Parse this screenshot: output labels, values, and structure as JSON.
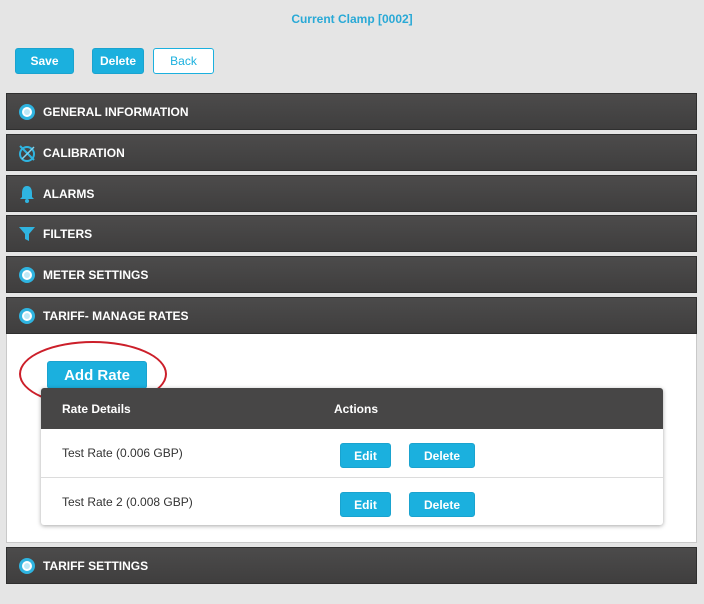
{
  "page": {
    "title": "Current Clamp [0002]"
  },
  "toolbar": {
    "save_label": "Save",
    "delete_label": "Delete",
    "back_label": "Back"
  },
  "sections": {
    "general": "GENERAL INFORMATION",
    "calibration": "CALIBRATION",
    "alarms": "ALARMS",
    "filters": "FILTERS",
    "meter": "METER SETTINGS",
    "tariff_rates": "TARIFF- MANAGE RATES",
    "tariff_settings": "TARIFF SETTINGS"
  },
  "tariff": {
    "add_rate_label": "Add Rate",
    "columns": {
      "details": "Rate Details",
      "actions": "Actions"
    },
    "rows": [
      {
        "name": "Test Rate (0.006 GBP)",
        "edit_label": "Edit",
        "delete_label": "Delete"
      },
      {
        "name": "Test Rate 2 (0.008 GBP)",
        "edit_label": "Edit",
        "delete_label": "Delete"
      }
    ]
  },
  "icons": {
    "general": "radio-dot-icon",
    "calibration": "compass-icon",
    "alarms": "bell-icon",
    "filters": "funnel-icon",
    "meter": "radio-dot-icon",
    "tariff_rates": "radio-dot-icon",
    "tariff_settings": "radio-dot-icon"
  },
  "colors": {
    "accent": "#1bb0de",
    "title": "#29a9d6",
    "header_bar": "#474646",
    "highlight_ellipse": "#cc1f2a",
    "background": "#e5e5e5"
  }
}
